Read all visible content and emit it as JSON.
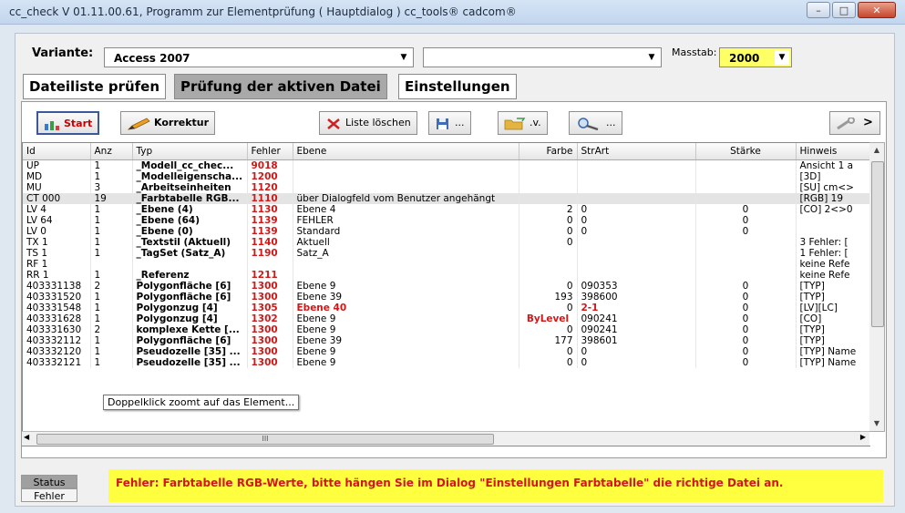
{
  "window": {
    "title": "cc_check V 01.11.00.61, Programm zur Elementprüfung ( Hauptdialog ) cc_tools® cadcom®",
    "min_label": "–",
    "max_label": "□",
    "close_label": "✕"
  },
  "top": {
    "variante_label": "Variante:",
    "variante_value": "Access 2007",
    "second_value": "",
    "masstab_label": "Masstab:",
    "masstab_value": "2000"
  },
  "tabs": [
    {
      "label": "Dateiliste prüfen"
    },
    {
      "label": "Prüfung der aktiven Datei"
    },
    {
      "label": "Einstellungen"
    }
  ],
  "toolbar": {
    "start": "Start",
    "korrektur": "Korrektur",
    "liste_loeschen": "Liste löschen",
    "save_suffix": "...",
    "open_suffix": ".v.",
    "search_suffix": "...",
    "more": ">"
  },
  "columns": [
    "Id",
    "Anz",
    "Typ",
    "Fehler",
    "Ebene",
    "Farbe",
    "StrArt",
    "Stärke",
    "Hinweis"
  ],
  "rows": [
    {
      "id": "UP",
      "anz": "1",
      "typ": "_Modell_cc_chec...",
      "fehler": "9018",
      "ebene": "",
      "farbe": "",
      "strart": "",
      "staerke": "",
      "hinweis": "Ansicht 1 a"
    },
    {
      "id": "MD",
      "anz": "1",
      "typ": "_Modelleigenscha...",
      "fehler": "1200",
      "ebene": "",
      "farbe": "",
      "strart": "",
      "staerke": "",
      "hinweis": "[3D]"
    },
    {
      "id": "MU",
      "anz": "3",
      "typ": "_Arbeitseinheiten",
      "fehler": "1120",
      "ebene": "",
      "farbe": "",
      "strart": "",
      "staerke": "",
      "hinweis": "[SU] cm<>"
    },
    {
      "id": "CT 000",
      "anz": "19",
      "typ": "_Farbtabelle RGB...",
      "fehler": "1110",
      "ebene": "über Dialogfeld vom Benutzer angehängt",
      "farbe": "",
      "strart": "",
      "staerke": "",
      "hinweis": "[RGB] 19"
    },
    {
      "id": "LV 4",
      "anz": "1",
      "typ": "_Ebene (4)",
      "fehler": "1130",
      "ebene": "Ebene 4",
      "farbe": "2",
      "strart": "0",
      "staerke": "0",
      "hinweis": "[CO] 2<>0"
    },
    {
      "id": "LV 64",
      "anz": "1",
      "typ": "_Ebene (64)",
      "fehler": "1139",
      "ebene": "FEHLER",
      "farbe": "0",
      "strart": "0",
      "staerke": "0",
      "hinweis": ""
    },
    {
      "id": "LV 0",
      "anz": "1",
      "typ": "_Ebene (0)",
      "fehler": "1139",
      "ebene": "Standard",
      "farbe": "0",
      "strart": "0",
      "staerke": "0",
      "hinweis": ""
    },
    {
      "id": "TX 1",
      "anz": "1",
      "typ": "_Textstil (Aktuell)",
      "fehler": "1140",
      "ebene": "Aktuell",
      "farbe": "0",
      "strart": "",
      "staerke": "",
      "hinweis": "3 Fehler: ["
    },
    {
      "id": "TS 1",
      "anz": "1",
      "typ": "_TagSet (Satz_A)",
      "fehler": "1190",
      "ebene": "Satz_A",
      "farbe": "",
      "strart": "",
      "staerke": "",
      "hinweis": "1 Fehler: ["
    },
    {
      "id": "RF 1",
      "anz": "",
      "typ": "",
      "fehler": "",
      "ebene": "",
      "farbe": "",
      "strart": "",
      "staerke": "",
      "hinweis": "keine Refe"
    },
    {
      "id": "RR 1",
      "anz": "1",
      "typ": "_Referenz",
      "fehler": "1211",
      "ebene": "",
      "farbe": "",
      "strart": "",
      "staerke": "",
      "hinweis": "keine Refe"
    },
    {
      "id": "403331138",
      "anz": "2",
      "typ": "Polygonfläche [6]",
      "fehler": "1300",
      "ebene": "Ebene 9",
      "farbe": "0",
      "strart": "090353",
      "staerke": "0",
      "hinweis": "[TYP]"
    },
    {
      "id": "403331520",
      "anz": "1",
      "typ": "Polygonfläche [6]",
      "fehler": "1300",
      "ebene": "Ebene 39",
      "farbe": "193",
      "strart": "398600",
      "staerke": "0",
      "hinweis": "[TYP]"
    },
    {
      "id": "403331548",
      "anz": "1",
      "typ": "Polygonzug [4]",
      "fehler": "1305",
      "ebene": "Ebene 40",
      "farbe": "0",
      "strart": "2-1",
      "staerke": "0",
      "hinweis": "[LV][LC]"
    },
    {
      "id": "403331628",
      "anz": "1",
      "typ": "Polygonzug [4]",
      "fehler": "1302",
      "ebene": "Ebene 9",
      "farbe": "ByLevel",
      "strart": "090241",
      "staerke": "0",
      "hinweis": "[CO]"
    },
    {
      "id": "403331630",
      "anz": "2",
      "typ": "komplexe Kette [...",
      "fehler": "1300",
      "ebene": "Ebene 9",
      "farbe": "0",
      "strart": "090241",
      "staerke": "0",
      "hinweis": "[TYP]"
    },
    {
      "id": "403332112",
      "anz": "1",
      "typ": "Polygonfläche [6]",
      "fehler": "1300",
      "ebene": "Ebene 39",
      "farbe": "177",
      "strart": "398601",
      "staerke": "0",
      "hinweis": "[TYP]"
    },
    {
      "id": "403332120",
      "anz": "1",
      "typ": "Pseudozelle [35] ...",
      "fehler": "1300",
      "ebene": "Ebene 9",
      "farbe": "0",
      "strart": "0",
      "staerke": "0",
      "hinweis": "[TYP] Name"
    },
    {
      "id": "403332121",
      "anz": "1",
      "typ": "Pseudozelle [35] ...",
      "fehler": "1300",
      "ebene": "Ebene 9",
      "farbe": "0",
      "strart": "0",
      "staerke": "0",
      "hinweis": "[TYP] Name"
    }
  ],
  "tooltip": "Doppelklick zoomt auf das Element...",
  "scroll_thumb_label": "III",
  "status": {
    "status_label": "Status",
    "fehler_label": "Fehler"
  },
  "message": "Fehler: Farbtabelle RGB-Werte, bitte hängen Sie im Dialog \"Einstellungen Farbtabelle\" die richtige Datei an."
}
